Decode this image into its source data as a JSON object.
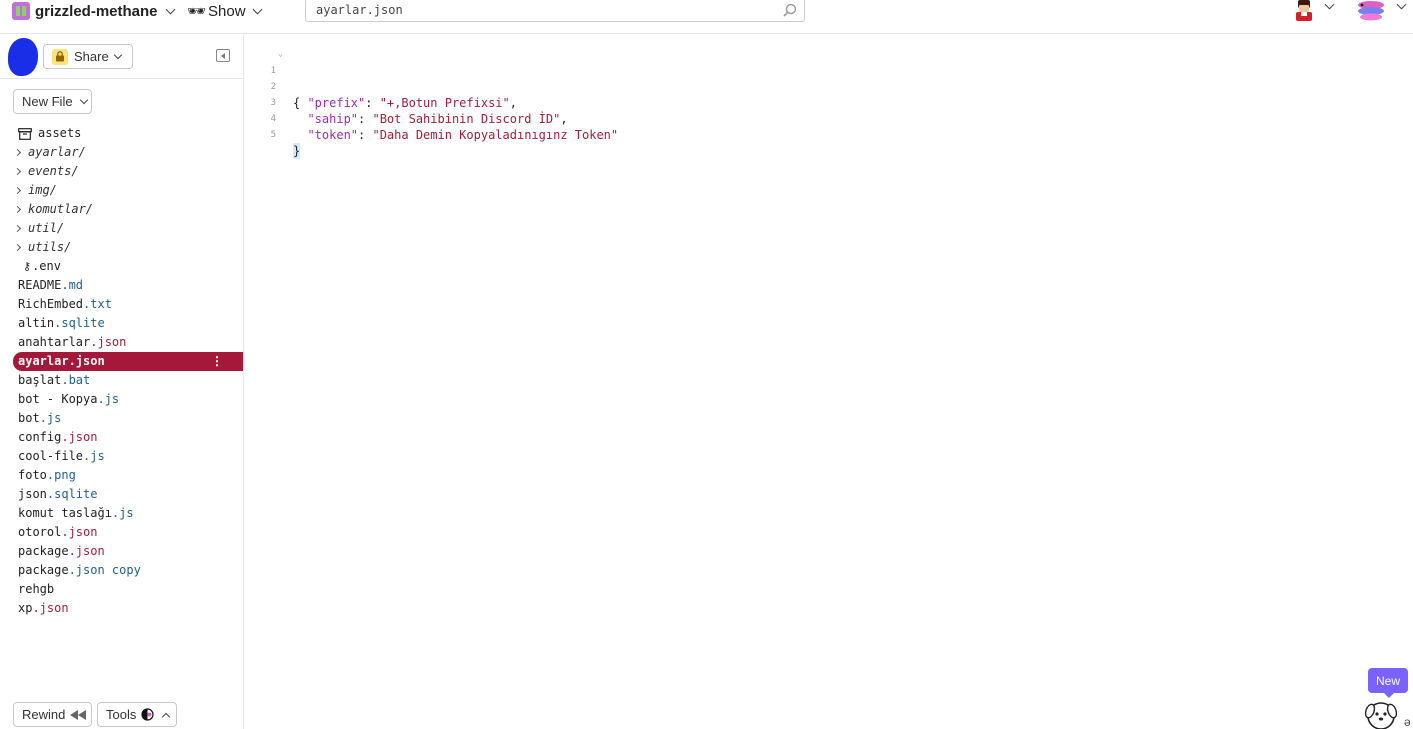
{
  "header": {
    "project_name": "grizzled-methane",
    "show_label": "Show",
    "search_value": "ayarlar.json"
  },
  "sidebar": {
    "share_label": "Share",
    "new_file_label": "New File",
    "tree": [
      {
        "type": "assets",
        "name": "assets",
        "ext": ""
      },
      {
        "type": "dir",
        "name": "ayarlar/",
        "ext": ""
      },
      {
        "type": "dir",
        "name": "events/",
        "ext": ""
      },
      {
        "type": "dir",
        "name": "img/",
        "ext": ""
      },
      {
        "type": "dir",
        "name": "komutlar/",
        "ext": ""
      },
      {
        "type": "dir",
        "name": "util/",
        "ext": ""
      },
      {
        "type": "dir",
        "name": "utils/",
        "ext": ""
      },
      {
        "type": "env",
        "name": ".env",
        "ext": ""
      },
      {
        "type": "file",
        "name": "README",
        "ext": ".md",
        "ext_color": "blue"
      },
      {
        "type": "file",
        "name": "RichEmbed",
        "ext": ".txt",
        "ext_color": "blue"
      },
      {
        "type": "file",
        "name": "altin",
        "ext": ".sqlite",
        "ext_color": "blue"
      },
      {
        "type": "file",
        "name": "anahtarlar",
        "ext": ".json",
        "ext_color": "red"
      },
      {
        "type": "file",
        "name": "ayarlar",
        "ext": ".json",
        "ext_color": "red",
        "selected": true
      },
      {
        "type": "file",
        "name": "başlat",
        "ext": ".bat",
        "ext_color": "blue"
      },
      {
        "type": "file",
        "name": "bot - Kopya",
        "ext": ".js",
        "ext_color": "blue"
      },
      {
        "type": "file",
        "name": "bot",
        "ext": ".js",
        "ext_color": "blue"
      },
      {
        "type": "file",
        "name": "config",
        "ext": ".json",
        "ext_color": "red"
      },
      {
        "type": "file",
        "name": "cool-file",
        "ext": ".js",
        "ext_color": "blue"
      },
      {
        "type": "file",
        "name": "foto",
        "ext": ".png",
        "ext_color": "blue"
      },
      {
        "type": "file",
        "name": "json",
        "ext": ".sqlite",
        "ext_color": "blue"
      },
      {
        "type": "file",
        "name": "komut taslağı",
        "ext": ".js",
        "ext_color": "blue"
      },
      {
        "type": "file",
        "name": "otorol",
        "ext": ".json",
        "ext_color": "red"
      },
      {
        "type": "file",
        "name": "package",
        "ext": ".json",
        "ext_color": "red"
      },
      {
        "type": "file",
        "name": "package",
        "ext": ".json copy",
        "ext_color": "blue"
      },
      {
        "type": "file",
        "name": "rehgb",
        "ext": "",
        "ext_color": "blue"
      },
      {
        "type": "file",
        "name": "xp",
        "ext": ".json",
        "ext_color": "red"
      }
    ],
    "rewind_label": "Rewind",
    "tools_label": "Tools"
  },
  "editor": {
    "lines": [
      {
        "n": "1",
        "open": "{"
      },
      {
        "n": "2",
        "key": "\"prefix\"",
        "value": "\"+,Botun Prefixsi\"",
        "trail": ","
      },
      {
        "n": "3",
        "key": "\"sahip\"",
        "value": "\"Bot Sahibinin Discord İD\"",
        "trail": ","
      },
      {
        "n": "4",
        "key": "\"token\"",
        "value": "\"Daha Demin Kopyaladınıgınz Token\"",
        "trail": ""
      },
      {
        "n": "5",
        "close": "}"
      }
    ]
  },
  "badge": {
    "new_label": "New"
  },
  "colors": {
    "selected_row": "#a4193a",
    "key": "#9b2fae",
    "string": "#a0203a",
    "ext_blue": "#1f5e8f",
    "badge": "#7b61ff"
  }
}
